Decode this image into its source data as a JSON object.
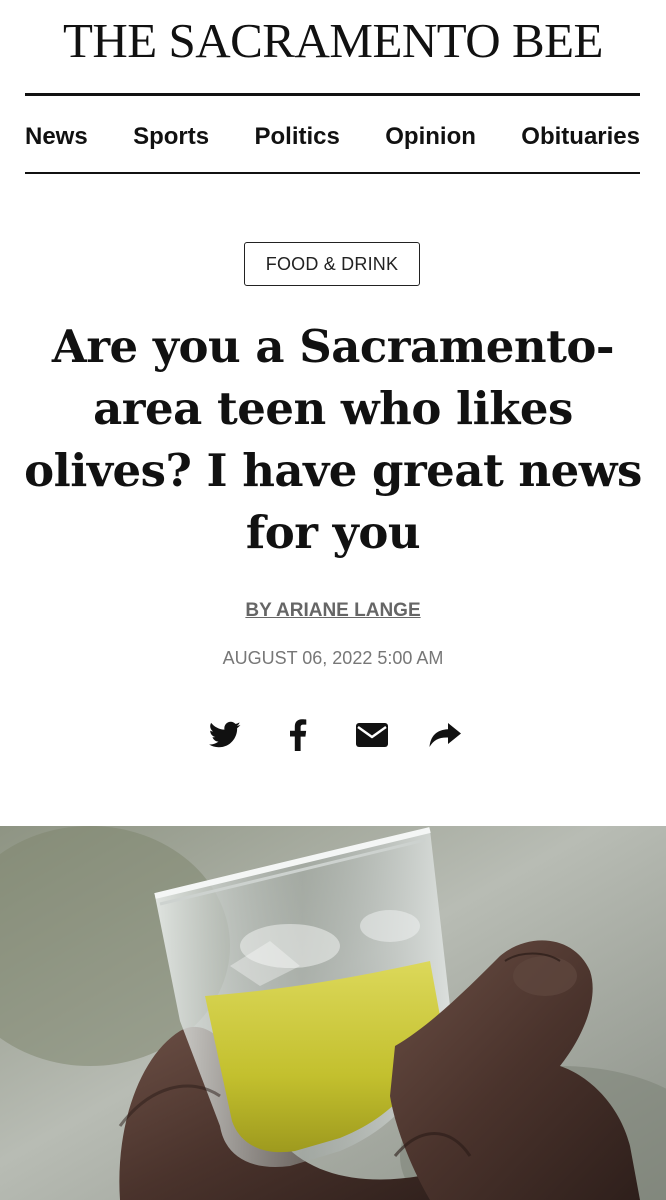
{
  "masthead": {
    "title": "THE SACRAMENTO BEE"
  },
  "nav": {
    "items": [
      "News",
      "Sports",
      "Politics",
      "Opinion",
      "Obituaries"
    ]
  },
  "article": {
    "section": "FOOD & DRINK",
    "headline": "Are you a Sacramento-area teen who likes olives? I have great news for you",
    "byline": "BY ARIANE LANGE",
    "date": "AUGUST 06, 2022 5:00 AM"
  },
  "share": {
    "icons": [
      "twitter-icon",
      "facebook-icon",
      "email-icon",
      "share-arrow-icon"
    ]
  },
  "hero_image": {
    "subject": "hand holding a small glass of olive oil"
  },
  "colors": {
    "text": "#111111",
    "byline": "#666666",
    "dateline": "#777777",
    "olive_oil": "#c9c63a"
  }
}
